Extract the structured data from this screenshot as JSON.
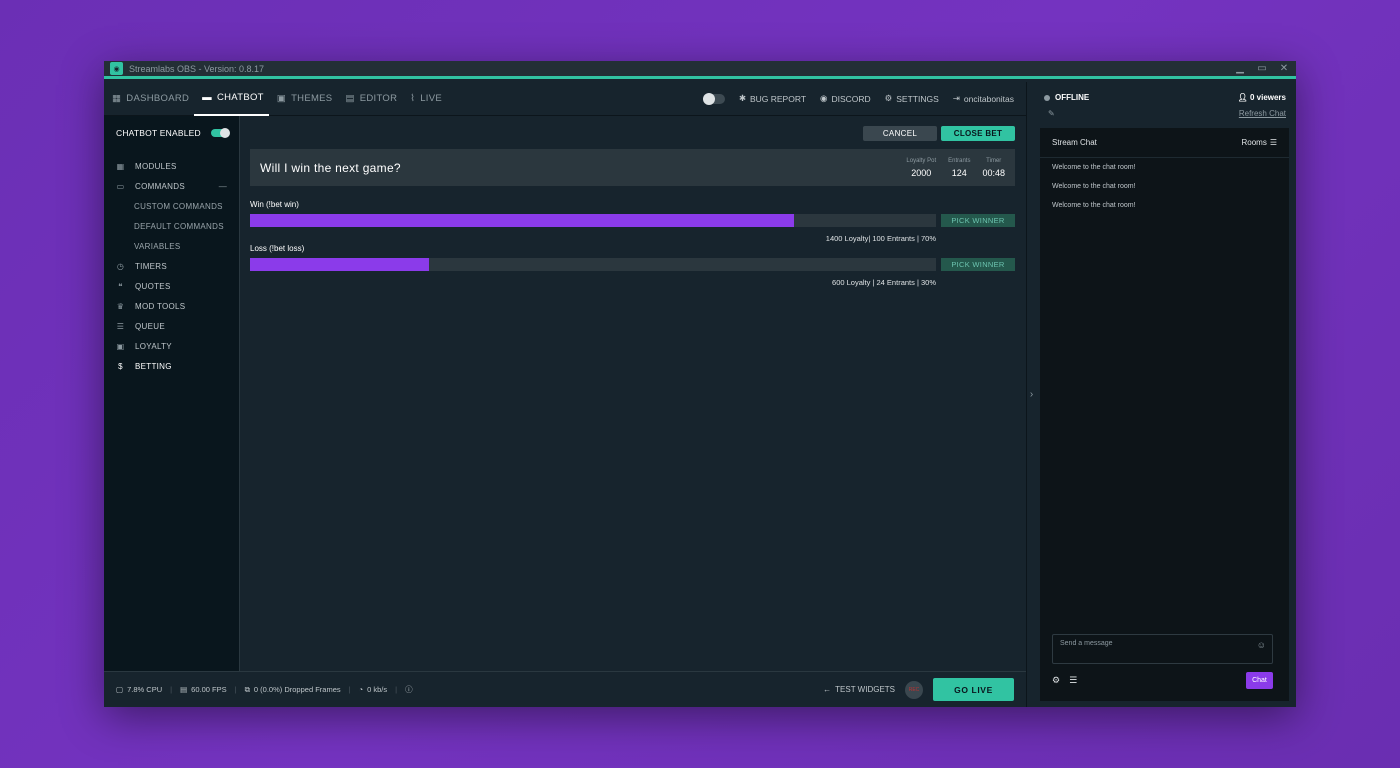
{
  "app": {
    "title": "Streamlabs OBS - Version: 0.8.17",
    "accent": "#31c3a2",
    "brand_purple": "#8b3bea"
  },
  "nav": {
    "tabs": [
      {
        "label": "DASHBOARD",
        "icon": "dashboard-icon"
      },
      {
        "label": "CHATBOT",
        "icon": "chat-icon",
        "active": true
      },
      {
        "label": "THEMES",
        "icon": "image-icon"
      },
      {
        "label": "EDITOR",
        "icon": "edit-icon"
      },
      {
        "label": "LIVE",
        "icon": "rss-icon"
      }
    ],
    "bug_report": "BUG REPORT",
    "discord": "DISCORD",
    "settings": "SETTINGS",
    "user": "oncitabonitas"
  },
  "sidebar": {
    "chatbot_enabled": "CHATBOT ENABLED",
    "items": [
      {
        "label": "MODULES",
        "icon": "grid-icon"
      },
      {
        "label": "COMMANDS",
        "icon": "message-icon"
      },
      {
        "label": "CUSTOM COMMANDS"
      },
      {
        "label": "DEFAULT COMMANDS"
      },
      {
        "label": "VARIABLES"
      },
      {
        "label": "TIMERS",
        "icon": "clock-icon"
      },
      {
        "label": "QUOTES",
        "icon": "quote-icon"
      },
      {
        "label": "MOD TOOLS",
        "icon": "crown-icon"
      },
      {
        "label": "QUEUE",
        "icon": "list-icon"
      },
      {
        "label": "LOYALTY",
        "icon": "loyalty-icon"
      },
      {
        "label": "BETTING",
        "icon": "dollar-icon",
        "active": true
      }
    ]
  },
  "betting": {
    "cancel": "CANCEL",
    "close_bet": "CLOSE BET",
    "question": "Will I win the next game?",
    "stats": {
      "loyalty_pot_label": "Loyalty Pot",
      "loyalty_pot": "2000",
      "entrants_label": "Entrants",
      "entrants": "124",
      "timer_label": "Timer",
      "timer": "00:48"
    },
    "options": [
      {
        "label": "Win (!bet win)",
        "percent": 0.7934,
        "pick": "PICK WINNER",
        "info": "1400 Loyalty| 100 Entrants | 70%"
      },
      {
        "label": "Loss (!bet loss)",
        "percent": 0.261,
        "pick": "PICK WINNER",
        "info": "600 Loyalty | 24 Entrants | 30%"
      }
    ]
  },
  "footer": {
    "cpu": "7.8% CPU",
    "fps": "60.00 FPS",
    "dropped": "0 (0.0%) Dropped Frames",
    "bandwidth": "0 kb/s",
    "test_widgets": "TEST WIDGETS",
    "rec": "REC",
    "go_live": "GO LIVE"
  },
  "chat": {
    "status": "OFFLINE",
    "viewers": "0 viewers",
    "refresh": "Refresh Chat",
    "title": "Stream Chat",
    "rooms": "Rooms",
    "messages": [
      "Welcome to the chat room!",
      "Welcome to the chat room!",
      "Welcome to the chat room!"
    ],
    "placeholder": "Send a message",
    "send": "Chat"
  }
}
